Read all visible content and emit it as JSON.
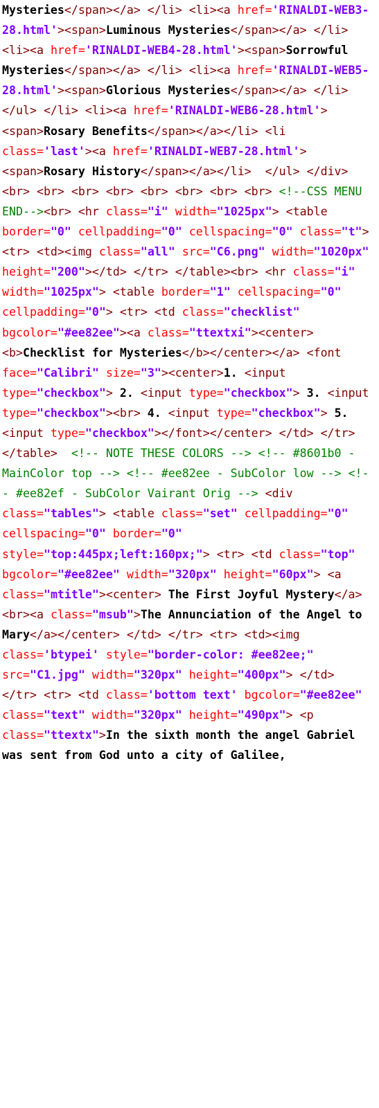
{
  "colors": {
    "tag": "#800000",
    "attr_name": "#ff0000",
    "attr_value": "#8000ff",
    "text": "#000000",
    "comment": "#008000",
    "background": "#ffffff"
  },
  "tokens": [
    {
      "k": "tx",
      "v": "Mysteries"
    },
    {
      "k": "t",
      "v": "</span></a> </li> <li><a "
    },
    {
      "k": "an",
      "v": "href="
    },
    {
      "k": "av",
      "v": "'RINALDI-WEB3-28.html'"
    },
    {
      "k": "t",
      "v": "><span>"
    },
    {
      "k": "tx",
      "v": "Luminous Mysteries"
    },
    {
      "k": "t",
      "v": "</span></a> </li> <li><a "
    },
    {
      "k": "an",
      "v": "href="
    },
    {
      "k": "av",
      "v": "'RINALDI-WEB4-28.html'"
    },
    {
      "k": "t",
      "v": "><span>"
    },
    {
      "k": "tx",
      "v": "Sorrowful Mysteries"
    },
    {
      "k": "t",
      "v": "</span></a> </li> <li><a "
    },
    {
      "k": "an",
      "v": "href="
    },
    {
      "k": "av",
      "v": "'RINALDI-WEB5-28.html'"
    },
    {
      "k": "t",
      "v": "><span>"
    },
    {
      "k": "tx",
      "v": "Glorious Mysteries"
    },
    {
      "k": "t",
      "v": "</span></a> </li> </ul> </li> <li><a "
    },
    {
      "k": "an",
      "v": "href="
    },
    {
      "k": "av",
      "v": "'RINALDI-WEB6-28.html'"
    },
    {
      "k": "t",
      "v": "><span>"
    },
    {
      "k": "tx",
      "v": "Rosary Benefits"
    },
    {
      "k": "t",
      "v": "</span></a></li> <li "
    },
    {
      "k": "an",
      "v": "class="
    },
    {
      "k": "av",
      "v": "'last'"
    },
    {
      "k": "t",
      "v": "><a "
    },
    {
      "k": "an",
      "v": "href="
    },
    {
      "k": "av",
      "v": "'RINALDI-WEB7-28.html'"
    },
    {
      "k": "t",
      "v": "><span>"
    },
    {
      "k": "tx",
      "v": "Rosary History"
    },
    {
      "k": "t",
      "v": "</span></a></li>  </ul> </div> <br> <br> <br> <br> <br> <br> <br> <br> "
    },
    {
      "k": "c",
      "v": "<!--CSS MENU END-->"
    },
    {
      "k": "t",
      "v": "<br> <hr "
    },
    {
      "k": "an",
      "v": "class="
    },
    {
      "k": "av",
      "v": "\"i\""
    },
    {
      "k": "an",
      "v": " width="
    },
    {
      "k": "av",
      "v": "\"1025px\""
    },
    {
      "k": "t",
      "v": "> <table "
    },
    {
      "k": "an",
      "v": "border="
    },
    {
      "k": "av",
      "v": "\"0\""
    },
    {
      "k": "an",
      "v": " cellpadding="
    },
    {
      "k": "av",
      "v": "\"0\""
    },
    {
      "k": "an",
      "v": " cellspacing="
    },
    {
      "k": "av",
      "v": "\"0\""
    },
    {
      "k": "an",
      "v": " class="
    },
    {
      "k": "av",
      "v": "\"t\""
    },
    {
      "k": "t",
      "v": "> <tr> <td><img "
    },
    {
      "k": "an",
      "v": "class="
    },
    {
      "k": "av",
      "v": "\"all\""
    },
    {
      "k": "an",
      "v": " src="
    },
    {
      "k": "av",
      "v": "\"C6.png\""
    },
    {
      "k": "an",
      "v": " width="
    },
    {
      "k": "av",
      "v": "\"1020px\""
    },
    {
      "k": "an",
      "v": " height="
    },
    {
      "k": "av",
      "v": "\"200\""
    },
    {
      "k": "t",
      "v": "></td> </tr> </table><br> <hr "
    },
    {
      "k": "an",
      "v": "class="
    },
    {
      "k": "av",
      "v": "\"i\""
    },
    {
      "k": "an",
      "v": " width="
    },
    {
      "k": "av",
      "v": "\"1025px\""
    },
    {
      "k": "t",
      "v": "> <table "
    },
    {
      "k": "an",
      "v": "border="
    },
    {
      "k": "av",
      "v": "\"1\""
    },
    {
      "k": "an",
      "v": " cellspacing="
    },
    {
      "k": "av",
      "v": "\"0\""
    },
    {
      "k": "an",
      "v": " cellpadding="
    },
    {
      "k": "av",
      "v": "\"0\""
    },
    {
      "k": "t",
      "v": "> <tr> <td "
    },
    {
      "k": "an",
      "v": "class="
    },
    {
      "k": "av",
      "v": "\"checklist\""
    },
    {
      "k": "an",
      "v": " bgcolor="
    },
    {
      "k": "av",
      "v": "\"#ee82ee\""
    },
    {
      "k": "t",
      "v": "><a "
    },
    {
      "k": "an",
      "v": "class="
    },
    {
      "k": "av",
      "v": "\"ttextxi\""
    },
    {
      "k": "t",
      "v": "><center><b>"
    },
    {
      "k": "tx",
      "v": "Checklist for Mysteries"
    },
    {
      "k": "t",
      "v": "</b></center></a> <font "
    },
    {
      "k": "an",
      "v": "face="
    },
    {
      "k": "av",
      "v": "\"Calibri\""
    },
    {
      "k": "an",
      "v": " size="
    },
    {
      "k": "av",
      "v": "\"3\""
    },
    {
      "k": "t",
      "v": "><center>"
    },
    {
      "k": "tx",
      "v": "1. "
    },
    {
      "k": "t",
      "v": "<input "
    },
    {
      "k": "an",
      "v": "type="
    },
    {
      "k": "av",
      "v": "\"checkbox\""
    },
    {
      "k": "t",
      "v": ">"
    },
    {
      "k": "tx",
      "v": " 2. "
    },
    {
      "k": "t",
      "v": "<input "
    },
    {
      "k": "an",
      "v": "type="
    },
    {
      "k": "av",
      "v": "\"checkbox\""
    },
    {
      "k": "t",
      "v": ">"
    },
    {
      "k": "tx",
      "v": " 3. "
    },
    {
      "k": "t",
      "v": "<input "
    },
    {
      "k": "an",
      "v": "type="
    },
    {
      "k": "av",
      "v": "\"checkbox\""
    },
    {
      "k": "t",
      "v": "><br>"
    },
    {
      "k": "tx",
      "v": " 4. "
    },
    {
      "k": "t",
      "v": "<input "
    },
    {
      "k": "an",
      "v": "type="
    },
    {
      "k": "av",
      "v": "\"checkbox\""
    },
    {
      "k": "t",
      "v": ">"
    },
    {
      "k": "tx",
      "v": " 5. "
    },
    {
      "k": "t",
      "v": "<input "
    },
    {
      "k": "an",
      "v": "type="
    },
    {
      "k": "av",
      "v": "\"checkbox\""
    },
    {
      "k": "t",
      "v": "></font></center> </td> </tr> </table>  "
    },
    {
      "k": "c",
      "v": "<!-- NOTE THESE COLORS --> <!-- #8601b0 - MainColor top --> <!-- #ee82ee - SubColor low --> <!-- #ee82ef - SubColor Vairant Orig -->"
    },
    {
      "k": "t",
      "v": " <div "
    },
    {
      "k": "an",
      "v": "class="
    },
    {
      "k": "av",
      "v": "\"tables\""
    },
    {
      "k": "t",
      "v": "> <table "
    },
    {
      "k": "an",
      "v": "class="
    },
    {
      "k": "av",
      "v": "\"set\""
    },
    {
      "k": "an",
      "v": " cellpadding="
    },
    {
      "k": "av",
      "v": "\"0\""
    },
    {
      "k": "an",
      "v": " cellspacing="
    },
    {
      "k": "av",
      "v": "\"0\""
    },
    {
      "k": "an",
      "v": " border="
    },
    {
      "k": "av",
      "v": "\"0\""
    },
    {
      "k": "an",
      "v": " style="
    },
    {
      "k": "av",
      "v": "\"top:445px;left:160px;\""
    },
    {
      "k": "t",
      "v": "> <tr> <td "
    },
    {
      "k": "an",
      "v": "class="
    },
    {
      "k": "av",
      "v": "\"top\""
    },
    {
      "k": "an",
      "v": " bgcolor="
    },
    {
      "k": "av",
      "v": "\"#ee82ee\""
    },
    {
      "k": "an",
      "v": " width="
    },
    {
      "k": "av",
      "v": "\"320px\""
    },
    {
      "k": "an",
      "v": " height="
    },
    {
      "k": "av",
      "v": "\"60px\""
    },
    {
      "k": "t",
      "v": "> <a "
    },
    {
      "k": "an",
      "v": "class="
    },
    {
      "k": "av",
      "v": "\"mtitle\""
    },
    {
      "k": "t",
      "v": "><center>"
    },
    {
      "k": "tx",
      "v": " The First Joyful Mystery"
    },
    {
      "k": "t",
      "v": "</a><br><a "
    },
    {
      "k": "an",
      "v": "class="
    },
    {
      "k": "av",
      "v": "\"msub\""
    },
    {
      "k": "t",
      "v": ">"
    },
    {
      "k": "tx",
      "v": "The Annunciation of the Angel to Mary"
    },
    {
      "k": "t",
      "v": "</a></center> </td> </tr> <tr> <td><img "
    },
    {
      "k": "an",
      "v": "class="
    },
    {
      "k": "av",
      "v": "'btypei'"
    },
    {
      "k": "an",
      "v": " style="
    },
    {
      "k": "av",
      "v": "\"border-color: #ee82ee;\""
    },
    {
      "k": "an",
      "v": " src="
    },
    {
      "k": "av",
      "v": "\"C1.jpg\""
    },
    {
      "k": "an",
      "v": " width="
    },
    {
      "k": "av",
      "v": "\"320px\""
    },
    {
      "k": "an",
      "v": " height="
    },
    {
      "k": "av",
      "v": "\"400px\""
    },
    {
      "k": "t",
      "v": "> </td> </tr> <tr> <td "
    },
    {
      "k": "an",
      "v": "class="
    },
    {
      "k": "av",
      "v": "'bottom text'"
    },
    {
      "k": "an",
      "v": " bgcolor="
    },
    {
      "k": "av",
      "v": "\"#ee82ee\""
    },
    {
      "k": "an",
      "v": " class="
    },
    {
      "k": "av",
      "v": "\"text\""
    },
    {
      "k": "an",
      "v": " width="
    },
    {
      "k": "av",
      "v": "\"320px\""
    },
    {
      "k": "an",
      "v": " height="
    },
    {
      "k": "av",
      "v": "\"490px\""
    },
    {
      "k": "t",
      "v": "> <p "
    },
    {
      "k": "an",
      "v": "class="
    },
    {
      "k": "av",
      "v": "\"ttextx\""
    },
    {
      "k": "t",
      "v": ">"
    },
    {
      "k": "tx",
      "v": "In the sixth month the angel Gabriel was sent from God unto a city of Galilee,"
    }
  ]
}
